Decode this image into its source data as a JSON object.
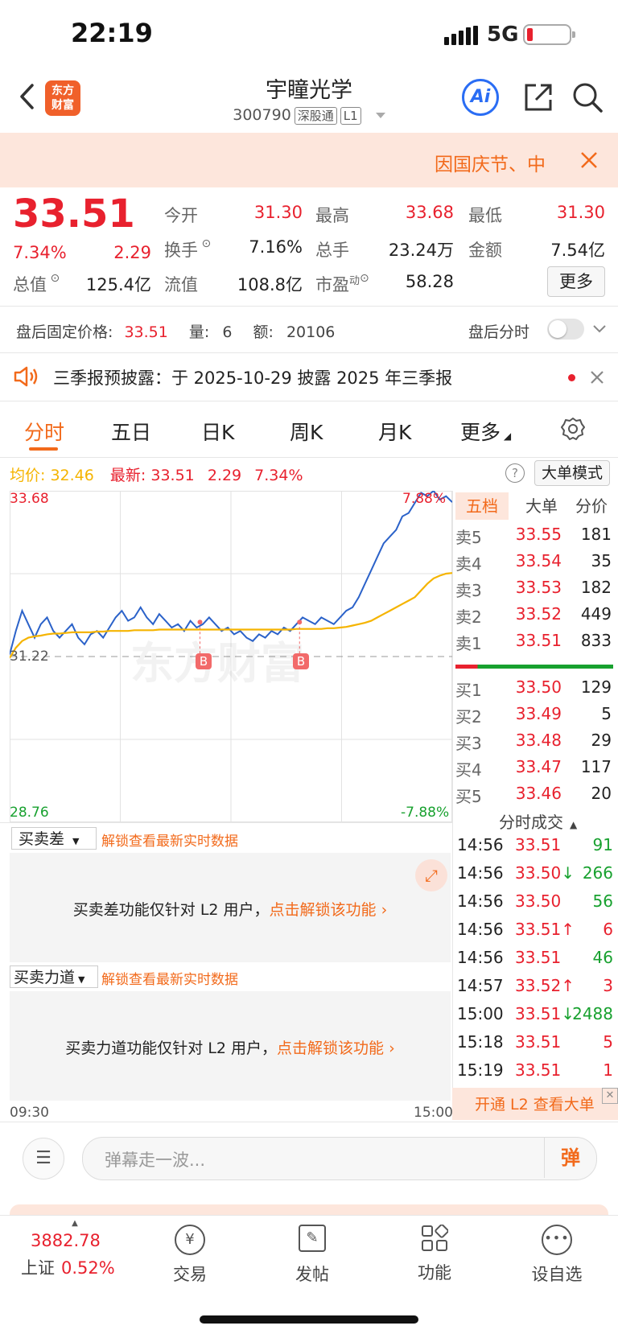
{
  "status_bar": {
    "time": "22:19",
    "network": "5G"
  },
  "header": {
    "title": "宇瞳光学",
    "code": "300790",
    "market_badge": "深股通",
    "level_badge": "L1",
    "ai_label": "Ai",
    "logo_text_1": "东方",
    "logo_text_2": "财富"
  },
  "notice": {
    "text": "因国庆节、中"
  },
  "quote": {
    "price": "33.51",
    "change_pct": "7.34%",
    "change_amt": "2.29",
    "open_label": "今开",
    "open": "31.30",
    "high_label": "最高",
    "high": "33.68",
    "low_label": "最低",
    "low": "31.30",
    "turnover_label": "换手",
    "turnover": "7.16%",
    "volume_label": "总手",
    "volume": "23.24万",
    "amount_label": "金额",
    "amount": "7.54亿",
    "mcap_label": "总值",
    "mcap": "125.4亿",
    "float_label": "流值",
    "float": "108.8亿",
    "pe_label": "市盈",
    "pe_sup": "动",
    "pe": "58.28",
    "more_label": "更多"
  },
  "after_hours": {
    "label": "盘后固定价格:",
    "price": "33.51",
    "qty_label": "量:",
    "qty": "6",
    "amt_label": "额:",
    "amt": "20106",
    "toggle_label": "盘后分时"
  },
  "announcement": {
    "text": "三季报预披露：于 2025-10-29 披露 2025 年三季报"
  },
  "tabs": [
    "分时",
    "五日",
    "日K",
    "周K",
    "月K",
    "更多"
  ],
  "chart_header": {
    "avg_label": "均价:",
    "avg": "32.46",
    "latest_label": "最新:",
    "latest": "33.51",
    "chg": "2.29",
    "pct": "7.34%",
    "mode_button": "大单模式"
  },
  "chart_labels": {
    "top_left": "33.68",
    "top_right": "7.88%",
    "mid_left": "31.22",
    "bottom_left": "28.76",
    "bottom_right": "-7.88%",
    "time_start": "09:30",
    "time_end": "15:00",
    "marker": "B",
    "watermark": "东方财富"
  },
  "chart_data": {
    "type": "line",
    "x_range": [
      "09:30",
      "15:00"
    ],
    "ylim": [
      28.76,
      33.68
    ],
    "prev_close": 31.22,
    "series": [
      {
        "values": [
          31.25,
          31.6,
          31.9,
          31.7,
          31.5,
          31.7,
          31.8,
          31.6,
          31.5,
          31.6,
          31.7,
          31.5,
          31.4,
          31.55,
          31.6,
          31.5,
          31.65,
          31.8,
          31.9,
          31.75,
          31.8,
          31.95,
          31.8,
          31.7,
          31.85,
          31.75,
          31.65,
          31.7,
          31.6,
          31.75,
          31.65,
          31.7,
          31.8,
          31.7,
          31.6,
          31.65,
          31.55,
          31.6,
          31.5,
          31.45,
          31.55,
          31.5,
          31.6,
          31.55,
          31.65,
          31.6,
          31.7,
          31.8,
          31.75,
          31.7,
          31.8,
          31.75,
          31.7,
          31.8,
          31.9,
          31.95,
          32.1,
          32.3,
          32.5,
          32.7,
          32.9,
          33.0,
          33.1,
          33.3,
          33.35,
          33.5,
          33.65,
          33.6,
          33.68,
          33.55,
          33.6,
          33.51
        ]
      },
      {
        "values": [
          31.2,
          31.35,
          31.45,
          31.5,
          31.52,
          31.53,
          31.55,
          31.56,
          31.56,
          31.57,
          31.58,
          31.58,
          31.58,
          31.58,
          31.59,
          31.59,
          31.6,
          31.6,
          31.6,
          31.6,
          31.61,
          31.61,
          31.61,
          31.61,
          31.62,
          31.62,
          31.62,
          31.62,
          31.62,
          31.62,
          31.62,
          31.62,
          31.62,
          31.62,
          31.62,
          31.62,
          31.62,
          31.62,
          31.62,
          31.62,
          31.62,
          31.62,
          31.62,
          31.62,
          31.62,
          31.62,
          31.63,
          31.63,
          31.63,
          31.63,
          31.63,
          31.64,
          31.64,
          31.65,
          31.66,
          31.68,
          31.7,
          31.72,
          31.75,
          31.8,
          31.85,
          31.9,
          31.95,
          32.0,
          32.05,
          32.1,
          32.2,
          32.3,
          32.38,
          32.42,
          32.45,
          32.46
        ]
      }
    ]
  },
  "book": {
    "tabs": [
      "五档",
      "大单",
      "分价"
    ],
    "asks": [
      {
        "label": "卖5",
        "price": "33.55",
        "vol": "181"
      },
      {
        "label": "卖4",
        "price": "33.54",
        "vol": "35"
      },
      {
        "label": "卖3",
        "price": "33.53",
        "vol": "182"
      },
      {
        "label": "卖2",
        "price": "33.52",
        "vol": "449"
      },
      {
        "label": "卖1",
        "price": "33.51",
        "vol": "833"
      }
    ],
    "bids": [
      {
        "label": "买1",
        "price": "33.50",
        "vol": "129"
      },
      {
        "label": "买2",
        "price": "33.49",
        "vol": "5"
      },
      {
        "label": "买3",
        "price": "33.48",
        "vol": "29"
      },
      {
        "label": "买4",
        "price": "33.47",
        "vol": "117"
      },
      {
        "label": "买5",
        "price": "33.46",
        "vol": "20"
      }
    ],
    "trades_title": "分时成交",
    "trades": [
      {
        "time": "14:56",
        "price": "33.51",
        "dir": "",
        "vol": "91",
        "color": "green"
      },
      {
        "time": "14:56",
        "price": "33.50",
        "dir": "↓",
        "vol": "266",
        "color": "green"
      },
      {
        "time": "14:56",
        "price": "33.50",
        "dir": "",
        "vol": "56",
        "color": "green"
      },
      {
        "time": "14:56",
        "price": "33.51",
        "dir": "↑",
        "vol": "6",
        "color": "red"
      },
      {
        "time": "14:56",
        "price": "33.51",
        "dir": "",
        "vol": "46",
        "color": "green"
      },
      {
        "time": "14:57",
        "price": "33.52",
        "dir": "↑",
        "vol": "3",
        "color": "red"
      },
      {
        "time": "15:00",
        "price": "33.51",
        "dir": "↓",
        "vol": "2488",
        "color": "green"
      },
      {
        "time": "15:18",
        "price": "33.51",
        "dir": "",
        "vol": "5",
        "color": "red"
      },
      {
        "time": "15:19",
        "price": "33.51",
        "dir": "",
        "vol": "1",
        "color": "red"
      }
    ],
    "l2_banner": "开通 L2 查看大单"
  },
  "panels": {
    "p1_select": "买卖差",
    "p1_unlock": "解锁查看最新实时数据",
    "p1_msg": "买卖差功能仅针对 L2 用户，",
    "p1_link": "点击解锁该功能",
    "p2_select": "买卖力道",
    "p2_unlock": "解锁查看最新实时数据",
    "p2_msg": "买卖力道功能仅针对 L2 用户，",
    "p2_link": "点击解锁该功能"
  },
  "comment": {
    "placeholder": "弹幕走一波...",
    "danmu_label": "弹"
  },
  "bottom_nav": {
    "index_value": "3882.78",
    "index_name": "上证",
    "index_pct": "0.52%",
    "items": [
      "交易",
      "发帖",
      "功能",
      "设自选"
    ]
  },
  "colors": {
    "up": "#e8212e",
    "down": "#18a12f",
    "accent": "#f26a1b",
    "price_line": "#2b62c9",
    "avg_line": "#f5b400"
  }
}
